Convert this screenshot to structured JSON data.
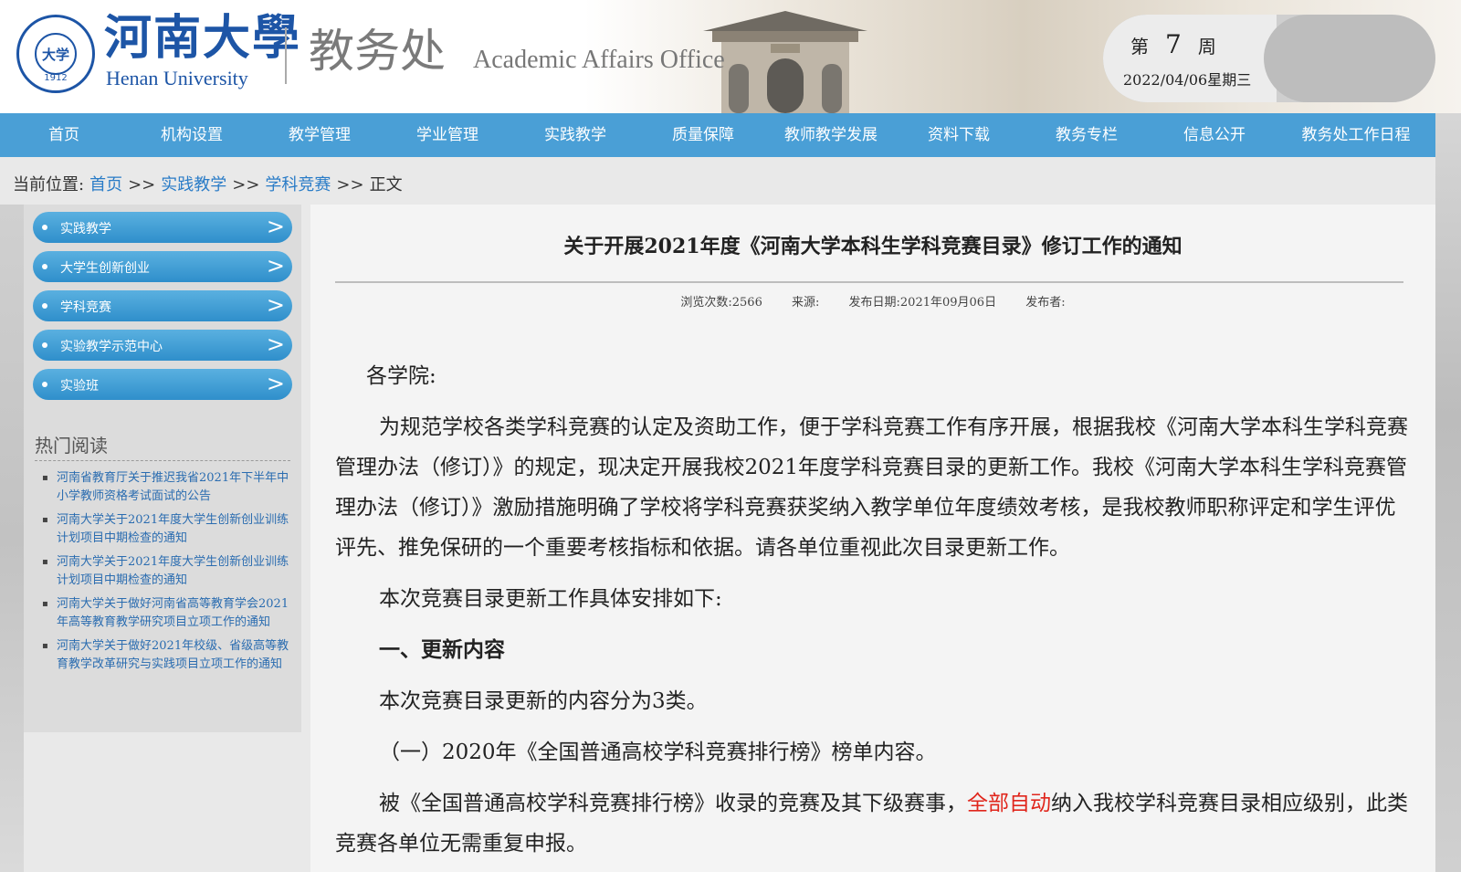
{
  "header": {
    "logo_cn": "河南大學",
    "logo_en": "Henan University",
    "seal_text": "大学",
    "seal_year": "1912",
    "office_cn": "教务处",
    "office_en": "Academic Affairs Office",
    "week_prefix": "第",
    "week_num": "7",
    "week_suffix": "周",
    "date": "2022/04/06星期三"
  },
  "nav": [
    "首页",
    "机构设置",
    "教学管理",
    "学业管理",
    "实践教学",
    "质量保障",
    "教师教学发展",
    "资料下载",
    "教务专栏",
    "信息公开",
    "教务处工作日程"
  ],
  "breadcrumb": {
    "prefix": "当前位置:",
    "items": [
      "首页",
      "实践教学",
      "学科竞赛"
    ],
    "sep": ">>",
    "current": "正文"
  },
  "sidebar": {
    "items": [
      "实践教学",
      "大学生创新创业",
      "学科竞赛",
      "实验教学示范中心",
      "实验班"
    ],
    "arrow": ">",
    "hot_title": "热门阅读",
    "hot_items": [
      "河南省教育厅关于推迟我省2021年下半年中小学教师资格考试面试的公告",
      "河南大学关于2021年度大学生创新创业训练计划项目中期检查的通知",
      "河南大学关于2021年度大学生创新创业训练计划项目中期检查的通知",
      "河南大学关于做好河南省高等教育学会2021年高等教育教学研究项目立项工作的通知",
      "河南大学关于做好2021年校级、省级高等教育教学改革研究与实践项目立项工作的通知"
    ]
  },
  "article": {
    "title": "关于开展2021年度《河南大学本科生学科竞赛目录》修订工作的通知",
    "views": "浏览次数:2566",
    "source": "来源:",
    "pubdate": "发布日期:2021年09月06日",
    "author": "发布者:",
    "salutation": "各学院:",
    "p1": "为规范学校各类学科竞赛的认定及资助工作，便于学科竞赛工作有序开展，根据我校《河南大学本科生学科竞赛管理办法（修订）》的规定，现决定开展我校2021年度学科竞赛目录的更新工作。我校《河南大学本科生学科竞赛管理办法（修订）》激励措施明确了学校将学科竞赛获奖纳入教学单位年度绩效考核，是我校教师职称评定和学生评优评先、推免保研的一个重要考核指标和依据。请各单位重视此次目录更新工作。",
    "p2": "本次竞赛目录更新工作具体安排如下:",
    "h1": "一、更新内容",
    "p3": "本次竞赛目录更新的内容分为3类。",
    "p4": "（一）2020年《全国普通高校学科竞赛排行榜》榜单内容。",
    "p5_a": "被《全国普通高校学科竞赛排行榜》收录的竞赛及其下级赛事，",
    "p5_red": "全部自动",
    "p5_b": "纳入我校学科竞赛目录相应级别，此类竞赛各单位无需重复申报。"
  }
}
